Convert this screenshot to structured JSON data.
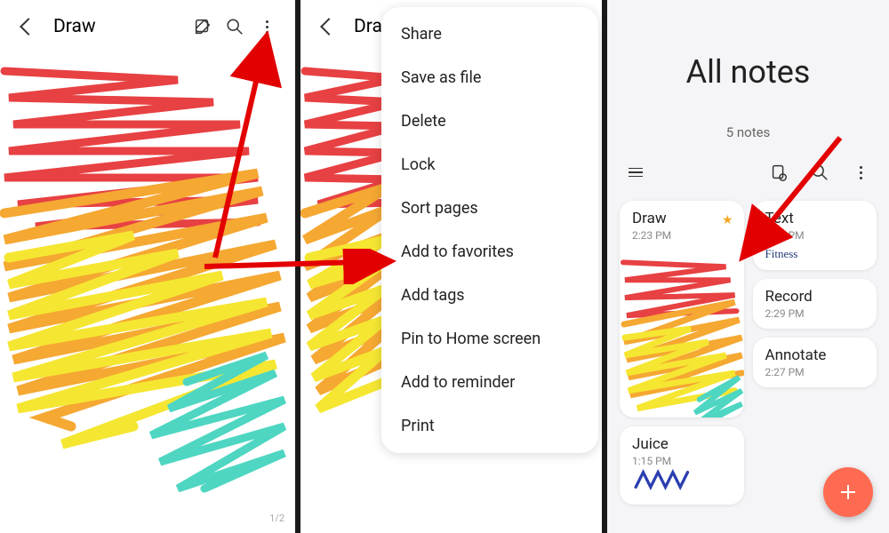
{
  "panel1": {
    "title": "Draw",
    "page_indicator": "1/2"
  },
  "panel2": {
    "title": "Drav",
    "menu": [
      "Share",
      "Save as file",
      "Delete",
      "Lock",
      "Sort pages",
      "Add to favorites",
      "Add tags",
      "Pin to Home screen",
      "Add to reminder",
      "Print"
    ],
    "highlighted_index": 5
  },
  "panel3": {
    "header_title": "All notes",
    "count": "5 notes",
    "notes_left": [
      {
        "title": "Draw",
        "time": "2:23 PM",
        "favorite": true,
        "thumb": "scribble"
      },
      {
        "title": "Juice",
        "time": "1:15 PM",
        "squiggle": true
      }
    ],
    "notes_right": [
      {
        "title": "Text",
        "time": "2:29 PM",
        "sig": "Fitness"
      },
      {
        "title": "Record",
        "time": "2:29 PM"
      },
      {
        "title": "Annotate",
        "time": "2:27 PM"
      }
    ]
  }
}
